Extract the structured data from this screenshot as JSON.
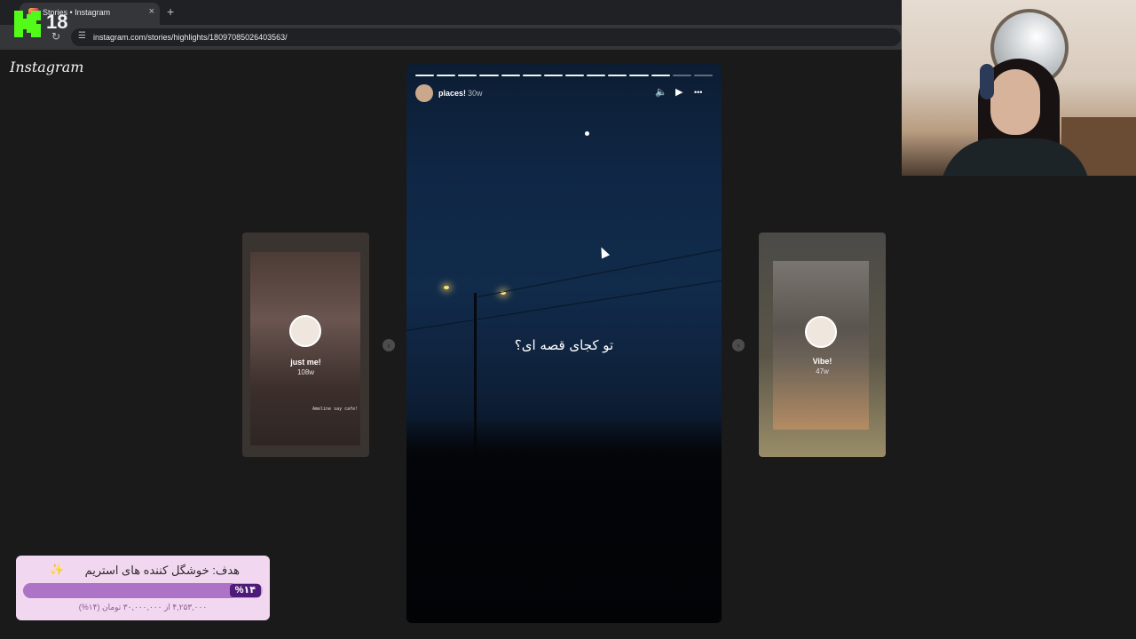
{
  "browser": {
    "tab_title": "Stories • Instagram",
    "tab_close": "×",
    "new_tab": "+",
    "url": "instagram.com/stories/highlights/18097085026403563/",
    "reload_icon": "reload-icon",
    "site_info_icon": "tune-icon"
  },
  "instagram": {
    "logo": "Instagram",
    "story": {
      "username": "places!",
      "time": "30w",
      "caption": "تو کجای قصه ای؟",
      "progress": {
        "segments": 14,
        "completed": 12
      },
      "controls": {
        "mute": "🔈",
        "play": "▶",
        "more": "•••"
      }
    },
    "prev_highlight": {
      "name": "just me!",
      "time": "108w",
      "note": "Ameline say cafe!"
    },
    "next_highlight": {
      "name": "Vibe!",
      "time": "47w"
    },
    "nav": {
      "prev": "‹",
      "next": "›"
    }
  },
  "stream_overlay": {
    "platform": "Kick",
    "viewer_badge": "18",
    "goal": {
      "title": "هدف: خوشگل کننده های استریم",
      "sparkle": "✨",
      "percent_label": "%۱۴",
      "percent": 14,
      "amount": "۴,۲۵۳,۰۰۰ از ۳۰,۰۰۰,۰۰۰ تومان (۱۴%)"
    }
  },
  "colors": {
    "kick_green": "#53fc18",
    "goal_bg": "#f2d7f1",
    "goal_fill": "#ad73c6",
    "goal_badge": "#4e1c78"
  }
}
